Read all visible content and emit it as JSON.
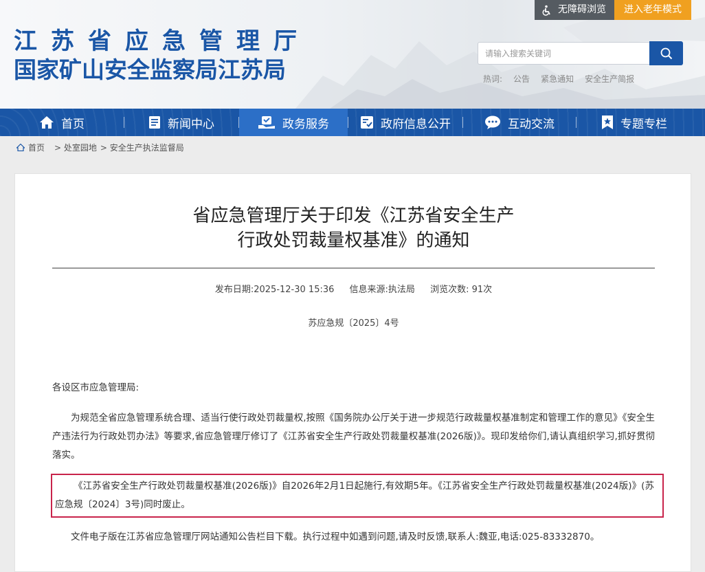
{
  "header": {
    "title_line1": "江苏省应急管理厅",
    "title_line2": "国家矿山安全监察局江苏局",
    "accessibility_label": "无障碍浏览",
    "elder_mode_label": "进入老年模式",
    "search": {
      "placeholder": "请输入搜索关键词"
    },
    "hot": {
      "label": "热词:",
      "words": [
        "公告",
        "紧急通知",
        "安全生产简报"
      ]
    }
  },
  "nav": {
    "items": [
      {
        "label": "首页",
        "icon": "home-icon"
      },
      {
        "label": "新闻中心",
        "icon": "news-icon"
      },
      {
        "label": "政务服务",
        "icon": "service-icon"
      },
      {
        "label": "政府信息公开",
        "icon": "info-public-icon"
      },
      {
        "label": "互动交流",
        "icon": "chat-icon"
      },
      {
        "label": "专题专栏",
        "icon": "bookmark-icon"
      }
    ],
    "active": "政务服务"
  },
  "breadcrumb": {
    "home": "首页",
    "items": [
      "> 处室园地",
      "> 安全生产执法监督局"
    ]
  },
  "article": {
    "title_line1": "省应急管理厅关于印发《江苏省安全生产",
    "title_line2": "行政处罚裁量权基准》的通知",
    "publish_date": "发布日期:2025-12-30 15:36",
    "source": "信息来源:执法局",
    "views": "浏览次数: 91次",
    "doc_number": "苏应急规〔2025〕4号",
    "salutation": "各设区市应急管理局:",
    "para1": "为规范全省应急管理系统合理、适当行使行政处罚裁量权,按照《国务院办公厅关于进一步规范行政裁量权基准制定和管理工作的意见》《安全生产违法行为行政处罚办法》等要求,省应急管理厅修订了《江苏省安全生产行政处罚裁量权基准(2026版)》。现印发给你们,请认真组织学习,抓好贯彻落实。",
    "para2": "《江苏省安全生产行政处罚裁量权基准(2026版)》自2026年2月1日起施行,有效期5年。《江苏省安全生产行政处罚裁量权基准(2024版)》(苏应急规〔2024〕3号)同时废止。",
    "para3": "文件电子版在江苏省应急管理厅网站通知公告栏目下载。执行过程中如遇到问题,请及时反馈,联系人:魏亚,电话:025-83332870。"
  },
  "colors": {
    "brand_blue": "#1a56a6",
    "nav_active": "#2c6fc7",
    "elder_orange": "#f0a020",
    "highlight_red": "#c8234a"
  }
}
